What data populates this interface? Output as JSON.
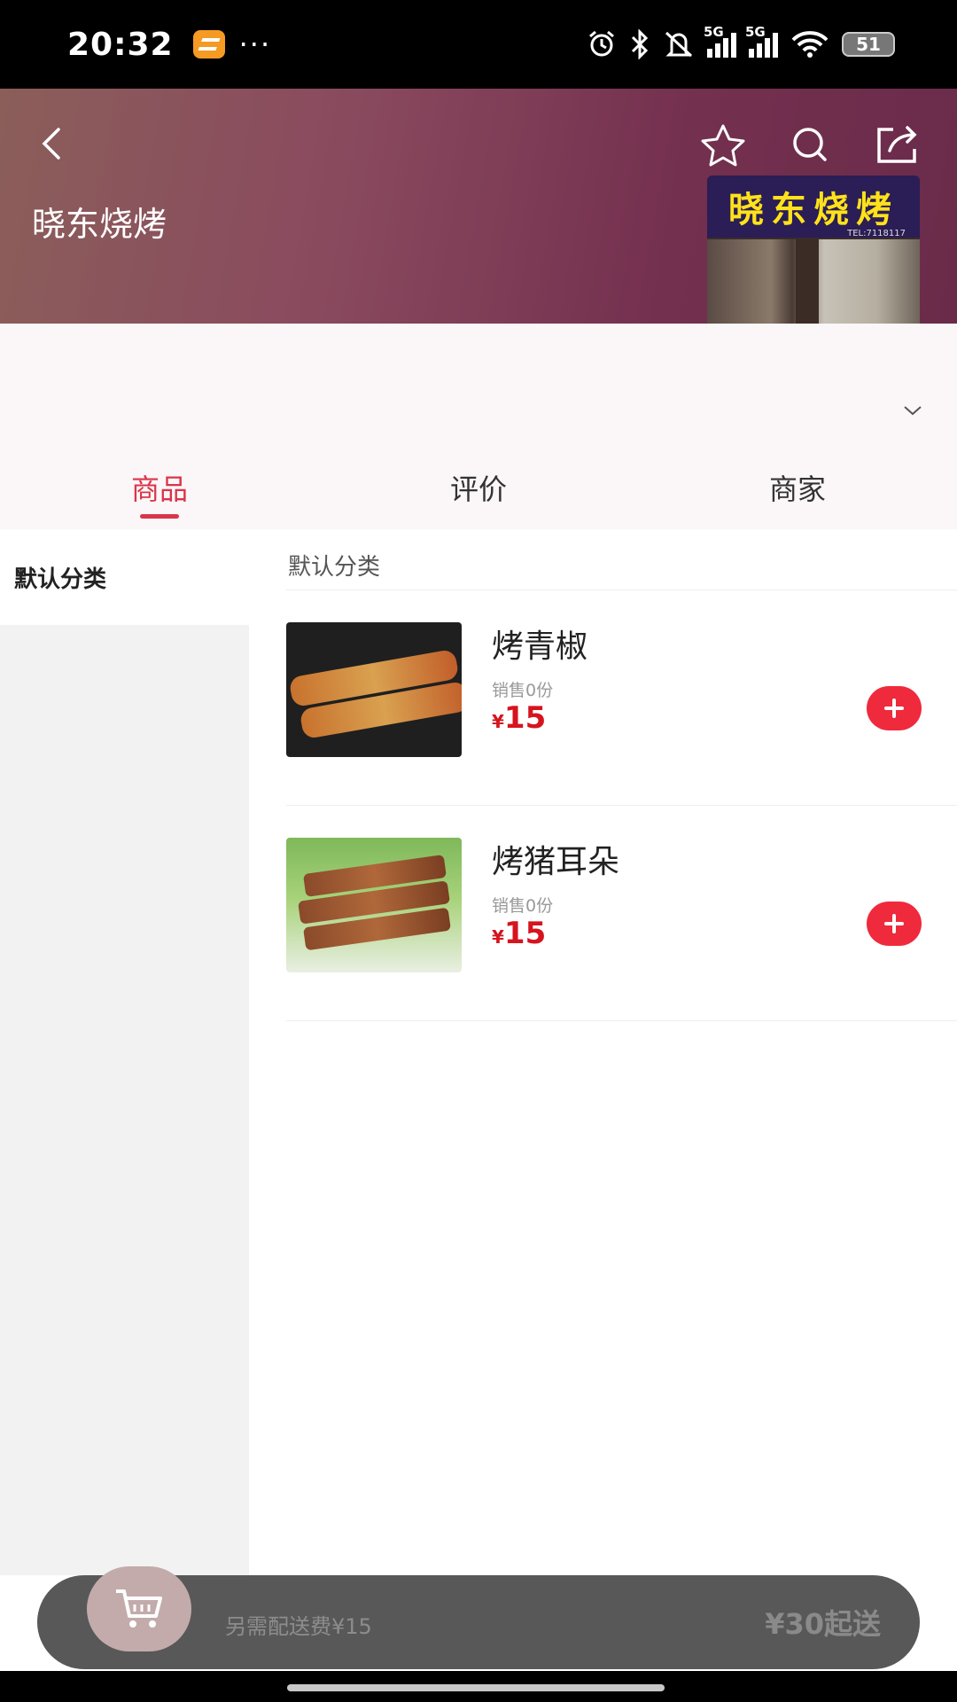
{
  "status_bar": {
    "time": "20:32",
    "dots": "···",
    "battery": "51",
    "network_1": "5G",
    "network_2": "5G"
  },
  "header": {
    "shop_name": "晓东烧烤",
    "sign_text": "晓东烧烤",
    "sign_tel": "TEL:7118117"
  },
  "tabs": [
    {
      "label": "商品",
      "active": true
    },
    {
      "label": "评价",
      "active": false
    },
    {
      "label": "商家",
      "active": false
    }
  ],
  "sidebar": {
    "items": [
      {
        "label": "默认分类",
        "selected": true
      }
    ]
  },
  "category": {
    "title": "默认分类"
  },
  "items": [
    {
      "name": "烤青椒",
      "sold": "销售0份",
      "currency": "¥",
      "price": "15"
    },
    {
      "name": "烤猪耳朵",
      "sold": "销售0份",
      "currency": "¥",
      "price": "15"
    }
  ],
  "cart": {
    "delivery_fee": "另需配送费¥15",
    "min_order": "¥30起送"
  },
  "colors": {
    "accent": "#d9354a",
    "price": "#d6141e",
    "add_button": "#ef2a3c",
    "cart_bar": "#585858"
  }
}
